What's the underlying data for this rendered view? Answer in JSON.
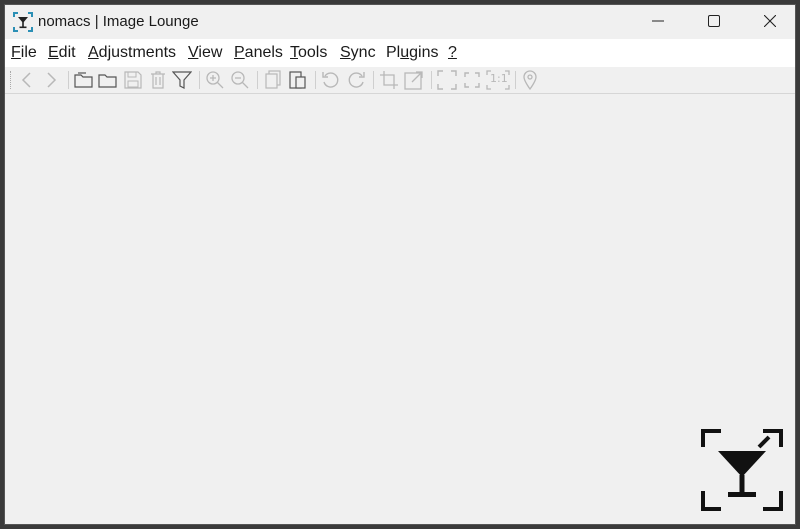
{
  "window": {
    "title": "nomacs | Image Lounge",
    "app_icon": "nomacs-glass-icon"
  },
  "titlebar_buttons": [
    {
      "name": "minimize-button",
      "icon": "minimize-icon"
    },
    {
      "name": "maximize-button",
      "icon": "maximize-icon"
    },
    {
      "name": "close-button",
      "icon": "close-icon"
    }
  ],
  "menu": {
    "file": {
      "mnemonic": "F",
      "rest": "ile"
    },
    "edit": {
      "mnemonic": "E",
      "rest": "dit"
    },
    "adjustments": {
      "mnemonic": "A",
      "rest": "djustments"
    },
    "view": {
      "mnemonic": "V",
      "rest": "iew"
    },
    "panels": {
      "mnemonic": "P",
      "rest": "anels"
    },
    "tools": {
      "mnemonic": "T",
      "rest": "ools"
    },
    "sync": {
      "mnemonic": "S",
      "rest": "ync"
    },
    "plugins_pre": "Pl",
    "plugins_mnemonic": "u",
    "plugins_post": "gins",
    "help": {
      "mnemonic": "?",
      "rest": ""
    }
  },
  "toolbar": {
    "buttons": [
      "previous-icon",
      "next-icon",
      "open-folder-icon",
      "browse-folder-icon",
      "save-icon",
      "delete-icon",
      "filter-icon",
      "zoom-in-icon",
      "zoom-out-icon",
      "copy-icon",
      "paste-icon",
      "rotate-left-icon",
      "rotate-right-icon",
      "crop-icon",
      "resize-icon",
      "fullscreen-icon",
      "fit-icon",
      "one-to-one-icon",
      "location-icon"
    ],
    "one_to_one_label": "1:1"
  },
  "colors": {
    "background": "#f0f0f0",
    "menubar": "#ffffff",
    "icon_disabled": "#b8b8b8",
    "app_icon_accent": "#2b8fb5",
    "logo": "#111111"
  }
}
